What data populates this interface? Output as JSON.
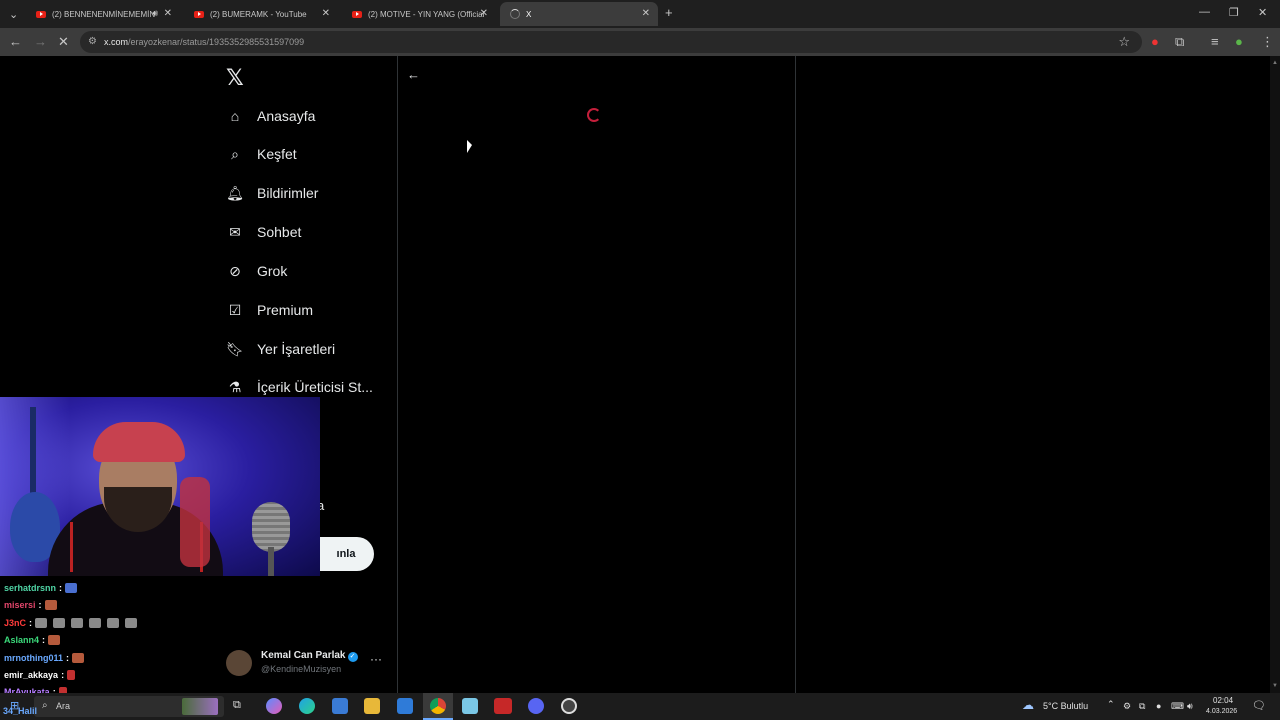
{
  "browser": {
    "tabs": [
      {
        "title": "(2) BENNENENMİNEMEMİN",
        "icon": "youtube-icon",
        "audio": true
      },
      {
        "title": "(2) BUMERAMK - YouTube",
        "icon": "youtube-icon"
      },
      {
        "title": "(2) MOTIVE - YIN YANG (Official",
        "icon": "youtube-icon"
      },
      {
        "title": "X",
        "icon": "loading-spinner-icon",
        "active": true
      }
    ],
    "url_host": "x.com",
    "url_path": "/erayozkenar/status/1935352985531597099"
  },
  "x_app": {
    "logo": "𝕏",
    "nav": [
      {
        "label": "Anasayfa",
        "icon": "home-icon",
        "glyph": "⌂"
      },
      {
        "label": "Keşfet",
        "icon": "search-icon",
        "glyph": "⌕"
      },
      {
        "label": "Bildirimler",
        "icon": "bell-icon",
        "glyph": "♫"
      },
      {
        "label": "Sohbet",
        "icon": "mail-icon",
        "glyph": "✉"
      },
      {
        "label": "Grok",
        "icon": "grok-icon",
        "glyph": "⊘"
      },
      {
        "label": "Premium",
        "icon": "premium-icon",
        "glyph": "✓"
      },
      {
        "label": "Yer İşaretleri",
        "icon": "bookmark-icon",
        "glyph": "⚑"
      },
      {
        "label": "İçerik Üreticisi St...",
        "icon": "flask-icon",
        "glyph": "⚗"
      }
    ],
    "partial_label": "a",
    "post_button_fragment": "ınla",
    "account": {
      "name": "Kemal Can Parlak",
      "handle": "@KendineMuzisyen"
    }
  },
  "stream_chat": [
    {
      "user": "serhatdrsnn",
      "color": "#4fd3a4",
      "emotes": [
        "#4a6fd0"
      ]
    },
    {
      "user": "misersi",
      "color": "#e0456a",
      "emotes": [
        "#b55a3c"
      ]
    },
    {
      "user": "J3nC",
      "color": "#ff3b3b",
      "emotes": [
        "#8a8a8a",
        "#8a8a8a",
        "#8a8a8a",
        "#8a8a8a",
        "#8a8a8a",
        "#8a8a8a"
      ]
    },
    {
      "user": "Aslann4",
      "color": "#3bd97a",
      "emotes": [
        "#b55a3c"
      ]
    },
    {
      "user": "mrnothing011",
      "color": "#6aa9ff",
      "emotes": [
        "#b55a3c"
      ]
    },
    {
      "user": "emir_akkaya",
      "color": "#ffffff",
      "emotes": [
        "#c23030"
      ]
    },
    {
      "user": "MrAvukata",
      "color": "#b57cff",
      "emotes": [
        "#c23030"
      ]
    }
  ],
  "taskbar": {
    "search_text": "Ara",
    "overlay_user": "34_Halil",
    "weather": "5°C  Bulutlu",
    "time": "02:04",
    "date": "4.03.2026"
  }
}
